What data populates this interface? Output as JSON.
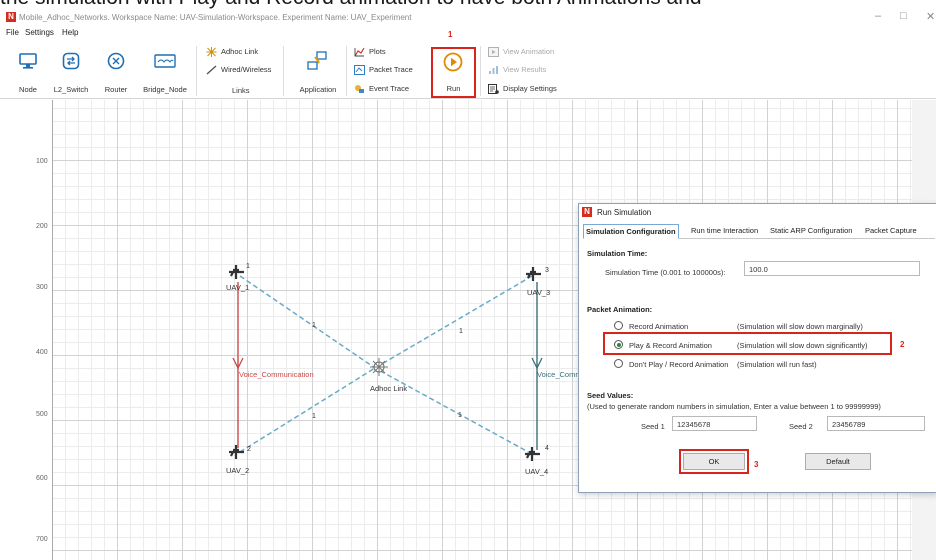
{
  "instruction_banner": "the simulation with Play and Record animation to have both Animations and",
  "window": {
    "title": "Mobile_Adhoc_Networks. Workspace Name: UAV-Simulation-Workspace. Experiment Name: UAV_Experiment",
    "minimize": "–",
    "restore": "□",
    "close": "✕"
  },
  "menu": [
    "File",
    "Settings",
    "Help"
  ],
  "ribbon": {
    "node": "Node",
    "l2_switch": "L2_Switch",
    "router": "Router",
    "bridge_node": "Bridge_Node",
    "adhoc_link": "Adhoc Link",
    "wired_wireless": "Wired/Wireless",
    "links_group": "Links",
    "application": "Application",
    "plots": "Plots",
    "packet_trace": "Packet Trace",
    "event_trace": "Event Trace",
    "run": "Run",
    "view_animation": "View Animation",
    "view_results": "View Results",
    "display_settings": "Display Settings"
  },
  "steps": {
    "one": "1",
    "two": "2",
    "three": "3"
  },
  "ruler": [
    "100",
    "200",
    "300",
    "400",
    "500",
    "600",
    "700"
  ],
  "network": {
    "nodes": [
      {
        "name": "UAV_1",
        "num": "1"
      },
      {
        "name": "UAV_2",
        "num": "2"
      },
      {
        "name": "UAV_3",
        "num": "3"
      },
      {
        "name": "UAV_4",
        "num": "4"
      }
    ],
    "adhoc_label": "Adhoc Link",
    "link_numbers": [
      "1",
      "1",
      "1",
      "1"
    ],
    "app_left": "Voice_Communication",
    "app_right": "Voice_Comm"
  },
  "dialog": {
    "title": "Run Simulation",
    "tabs": [
      "Simulation Configuration",
      "Run time Interaction",
      "Static ARP Configuration",
      "Packet Capture"
    ],
    "sim_time_header": "Simulation Time:",
    "sim_time_label": "Simulation Time (0.001 to 100000s):",
    "sim_time_value": "100.0",
    "packet_anim_header": "Packet Animation:",
    "options": [
      {
        "label": "Record Animation",
        "note": "(Simulation will slow down marginally)",
        "checked": false
      },
      {
        "label": "Play & Record Animation",
        "note": "(Simulation will slow down significantly)",
        "checked": true
      },
      {
        "label": "Don't Play / Record Animation",
        "note": "(Simulation will run fast)",
        "checked": false
      }
    ],
    "seed_header": "Seed Values:",
    "seed_note": "(Used to generate random numbers in simulation, Enter a value between 1 to 99999999)",
    "seed1_label": "Seed 1",
    "seed1_value": "12345678",
    "seed2_label": "Seed 2",
    "seed2_value": "23456789",
    "ok": "OK",
    "default": "Default"
  },
  "colors": {
    "highlight_red": "#d9241b",
    "link_dashed": "#6aaac8",
    "app_red": "#c94a4a",
    "app_teal": "#3b6f78",
    "accent_blue": "#1f6fb5"
  }
}
